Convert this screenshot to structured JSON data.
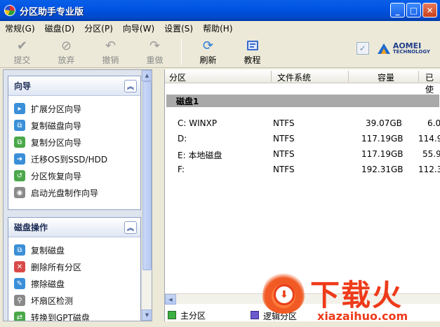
{
  "window": {
    "title": "分区助手专业版",
    "buttons": {
      "minimize": "_",
      "maximize": "□",
      "close": "✕"
    }
  },
  "menu": [
    "常规(G)",
    "磁盘(D)",
    "分区(P)",
    "向导(W)",
    "设置(S)",
    "帮助(H)"
  ],
  "toolbar": {
    "items": [
      {
        "label": "提交",
        "icon": "check-icon",
        "enabled": false
      },
      {
        "label": "放弃",
        "icon": "discard-icon",
        "enabled": false
      },
      {
        "label": "撤销",
        "icon": "undo-icon",
        "enabled": false
      },
      {
        "label": "重做",
        "icon": "redo-icon",
        "enabled": false
      },
      {
        "label": "刷新",
        "icon": "refresh-icon",
        "enabled": true
      },
      {
        "label": "教程",
        "icon": "tutorial-icon",
        "enabled": true
      }
    ],
    "brand_name": "AOMEI",
    "brand_sub": "TECHNOLOGY"
  },
  "wizard_panel": {
    "title": "向导",
    "collapse": "⌃",
    "items": [
      {
        "label": "扩展分区向导",
        "icon": "extend-partition-icon",
        "color": "#3a8fd8"
      },
      {
        "label": "复制磁盘向导",
        "icon": "copy-disk-icon",
        "color": "#3a8fd8"
      },
      {
        "label": "复制分区向导",
        "icon": "copy-partition-icon",
        "color": "#4aa84a"
      },
      {
        "label": "迁移OS到SSD/HDD",
        "icon": "migrate-os-icon",
        "color": "#3a8fd8"
      },
      {
        "label": "分区恢复向导",
        "icon": "partition-recovery-icon",
        "color": "#4aa84a"
      },
      {
        "label": "启动光盘制作向导",
        "icon": "boot-disc-icon",
        "color": "#8a8a8a"
      }
    ]
  },
  "disk_ops_panel": {
    "title": "磁盘操作",
    "collapse": "⌃",
    "items": [
      {
        "label": "复制磁盘",
        "icon": "copy-disk-icon",
        "color": "#3a8fd8"
      },
      {
        "label": "删除所有分区",
        "icon": "delete-partitions-icon",
        "color": "#d84a4a"
      },
      {
        "label": "擦除磁盘",
        "icon": "wipe-disk-icon",
        "color": "#3a8fd8"
      },
      {
        "label": "坏扇区检测",
        "icon": "bad-sector-icon",
        "color": "#8a8a8a"
      },
      {
        "label": "转换到GPT磁盘",
        "icon": "convert-gpt-icon",
        "color": "#4aa84a"
      }
    ]
  },
  "table": {
    "columns": [
      "分区",
      "文件系统",
      "容量",
      "已使"
    ],
    "disk_label": "磁盘1",
    "rows": [
      {
        "partition": "C: WINXP",
        "fs": "NTFS",
        "capacity": "39.07GB",
        "used": "6.0"
      },
      {
        "partition": "D:",
        "fs": "NTFS",
        "capacity": "117.19GB",
        "used": "114.9"
      },
      {
        "partition": "E: 本地磁盘",
        "fs": "NTFS",
        "capacity": "117.19GB",
        "used": "55.9"
      },
      {
        "partition": "F:",
        "fs": "NTFS",
        "capacity": "192.31GB",
        "used": "112.3"
      }
    ]
  },
  "legend": {
    "primary": "主分区",
    "logical": "逻辑分区"
  },
  "watermark": {
    "big": "下载火",
    "url": "xiazaihuo.com"
  }
}
